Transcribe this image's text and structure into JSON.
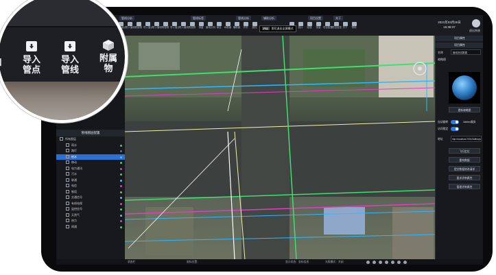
{
  "toolbar": {
    "groups": [
      "管线分析",
      "管线标签",
      "管线分析",
      "辅助分析",
      "项目设置",
      "关于"
    ],
    "tools": [
      "导入管点",
      "导入管线",
      "附属物",
      "导入管点",
      "导入管线",
      "附属物",
      "导入管点",
      "导入管线",
      "附属物",
      "测量",
      "管线分析",
      "淹没",
      "纵断面",
      "横断面",
      "开挖",
      "属性",
      "分析",
      "统计",
      "碰撞",
      "测量",
      "项目配置",
      "项目信息",
      "关于",
      "帮助"
    ],
    "fullscreen_key": "F11",
    "fullscreen_label": "即可退出全屏模式",
    "date": "2021年03月26日",
    "time": "15:38:37",
    "user": "退出系统"
  },
  "magnifier": {
    "tools": [
      "导入管点",
      "导入管线",
      "附属物"
    ],
    "left_fragment": "加"
  },
  "left_panel": {
    "title": "管线图层配置",
    "items": [
      {
        "label": "所有图层",
        "color": ""
      },
      {
        "label": "雨水",
        "color": "#3fd36b"
      },
      {
        "label": "路灯",
        "color": "#2f7be6"
      },
      {
        "label": "给水",
        "color": "#3fc6ff"
      },
      {
        "label": "移动",
        "color": "#3fd36b"
      },
      {
        "label": "电力通讯",
        "color": "#e03fbf"
      },
      {
        "label": "污水",
        "color": "#3fd36b"
      },
      {
        "label": "联通",
        "color": "#3fc6ff"
      },
      {
        "label": "电信",
        "color": "#e03fbf"
      },
      {
        "label": "铁塔",
        "color": "#3fd36b"
      },
      {
        "label": "交通信号",
        "color": "#3fc6ff"
      },
      {
        "label": "有线电视",
        "color": "#e03fbf"
      },
      {
        "label": "监控信号",
        "color": "#3fd36b"
      },
      {
        "label": "天然气",
        "color": "#3fc6ff"
      },
      {
        "label": "热力",
        "color": "#e03fbf"
      },
      {
        "label": "网通",
        "color": "#3fd36b"
      }
    ],
    "selected_index": 3
  },
  "right_panel": {
    "header1": "项目属性",
    "header2": "项目属性",
    "name_label": "名称",
    "name_value": "管线测试数据",
    "thumb_label": "缩略图",
    "change_thumb_button": "更新缩略图",
    "toggle1_label": "自动旋转",
    "toggle2_label": "访问限定",
    "sdk_label": "3dtiles服务",
    "url_label": "地址",
    "url_value": "http://localhost:7001/3dtiles/pdx1",
    "buttons": [
      "飞行定位",
      "重构数据",
      "提交数据修改请求",
      "要求评审属性",
      "管理评审属性"
    ]
  },
  "statusbar": {
    "left": "状态栏",
    "coords": "鼠标位置：",
    "display": "显示状态：坐标信息",
    "mode": "光照模式：关闭"
  }
}
